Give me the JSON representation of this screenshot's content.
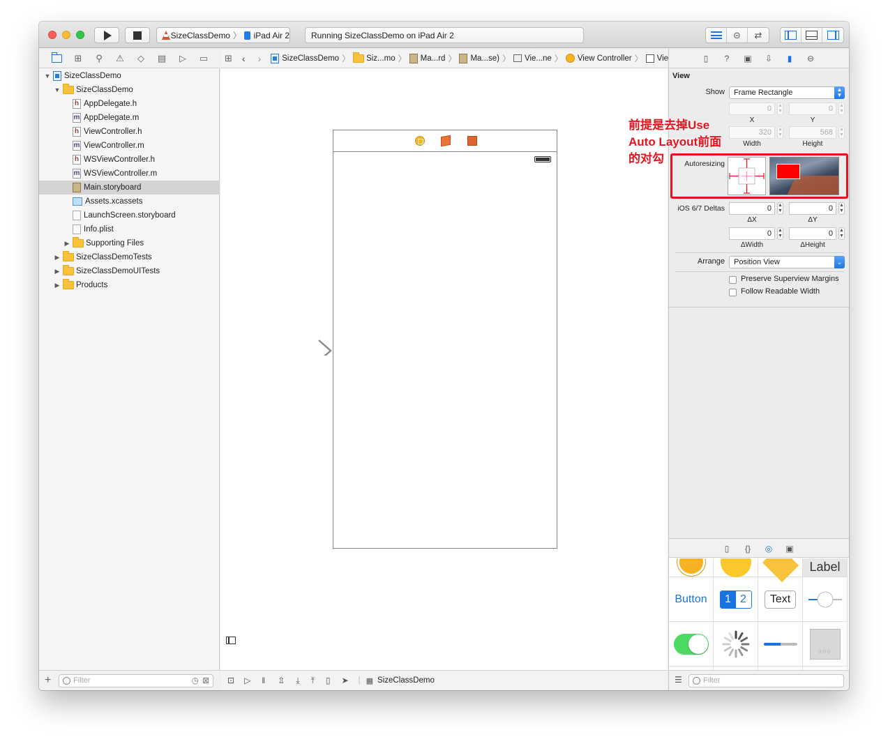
{
  "toolbar": {
    "scheme": "SizeClassDemo",
    "device": "iPad Air 2",
    "status": "Running SizeClassDemo on iPad Air 2"
  },
  "navigator": {
    "items": [
      {
        "label": "SizeClassDemo"
      },
      {
        "label": "SizeClassDemo"
      },
      {
        "label": "AppDelegate.h"
      },
      {
        "label": "AppDelegate.m"
      },
      {
        "label": "ViewController.h"
      },
      {
        "label": "ViewController.m"
      },
      {
        "label": "WSViewController.h"
      },
      {
        "label": "WSViewController.m"
      },
      {
        "label": "Main.storyboard"
      },
      {
        "label": "Assets.xcassets"
      },
      {
        "label": "LaunchScreen.storyboard"
      },
      {
        "label": "Info.plist"
      },
      {
        "label": "Supporting Files"
      },
      {
        "label": "SizeClassDemoTests"
      },
      {
        "label": "SizeClassDemoUITests"
      },
      {
        "label": "Products"
      }
    ],
    "filter_placeholder": "Filter"
  },
  "jumpbar": {
    "crumbs": [
      "SizeClassDemo",
      "Siz...mo",
      "Ma...rd",
      "Ma...se)",
      "Vie...ne",
      "View Controller",
      "View"
    ]
  },
  "editor": {
    "footer_label": "SizeClassDemo"
  },
  "inspector": {
    "section_title": "View",
    "show_label": "Show",
    "show_value": "Frame Rectangle",
    "x_label": "X",
    "y_label": "Y",
    "x_value": "0",
    "y_value": "0",
    "width_label": "Width",
    "height_label": "Height",
    "width_value": "320",
    "height_value": "568",
    "autoresizing_label": "Autoresizing",
    "deltas_label": "iOS 6/7 Deltas",
    "dx_label": "ΔX",
    "dy_label": "ΔY",
    "dx_value": "0",
    "dy_value": "0",
    "dwidth_label": "ΔWidth",
    "dheight_label": "ΔHeight",
    "dwidth_value": "0",
    "dheight_value": "0",
    "arrange_label": "Arrange",
    "arrange_value": "Position View",
    "preserve_margins": "Preserve Superview Margins",
    "follow_readable": "Follow Readable Width"
  },
  "library": {
    "button_label": "Button",
    "seg_1": "1",
    "seg_2": "2",
    "text_label": "Text",
    "partial_label": "Label",
    "filter_placeholder": "Filter"
  },
  "annotation": {
    "line1": "前提是去掉Use",
    "line2": "Auto Layout前面",
    "line3": "的对勾"
  },
  "colors": {
    "accent": "#1a74e0",
    "annotation": "#e8121c",
    "folder": "#f9c23c"
  }
}
